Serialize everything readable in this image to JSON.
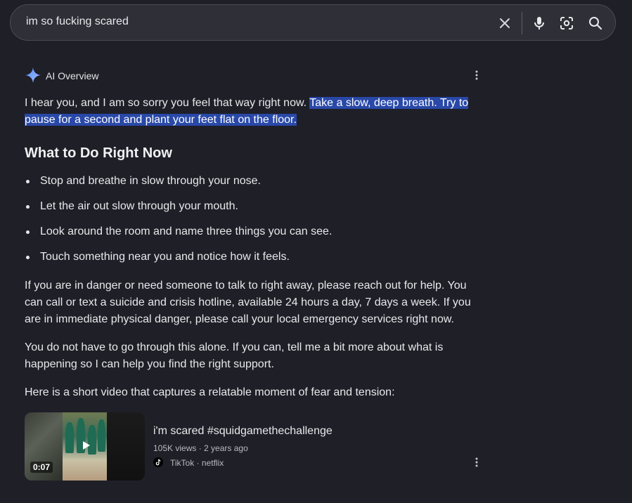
{
  "search": {
    "query": "im so fucking scared"
  },
  "ai_overview": {
    "label": "AI Overview",
    "intro_plain": "I hear you, and I am so sorry you feel that way right now. ",
    "intro_highlight": "Take a slow, deep breath. Try to pause for a second and plant your feet flat on the floor.",
    "heading": "What to Do Right Now",
    "bullets": [
      "Stop and breathe in slow through your nose.",
      "Let the air out slow through your mouth.",
      "Look around the room and name three things you can see.",
      "Touch something near you and notice how it feels."
    ],
    "para_danger": "If you are in danger or need someone to talk to right away, please reach out for help. You can call or text a suicide and crisis hotline, available 24 hours a day, 7 days a week. If you are in immediate physical danger, please call your local emergency services right now.",
    "para_alone": "You do not have to go through this alone. If you can, tell me a bit more about what is happening so I can help you find the right support.",
    "para_video": "Here is a short video that captures a relatable moment of fear and tension:"
  },
  "video": {
    "title": "i'm scared #squidgamethechallenge",
    "meta": "105K views · 2 years ago",
    "source": "TikTok · netflix",
    "duration": "0:07"
  },
  "colors": {
    "background": "#1f1f28",
    "highlight": "#2949a8",
    "search_bar": "#2e2f37"
  },
  "icons": [
    "clear-icon",
    "microphone-icon",
    "lens-icon",
    "search-icon",
    "sparkle-icon",
    "more-vert-icon",
    "play-icon",
    "tiktok-icon"
  ]
}
